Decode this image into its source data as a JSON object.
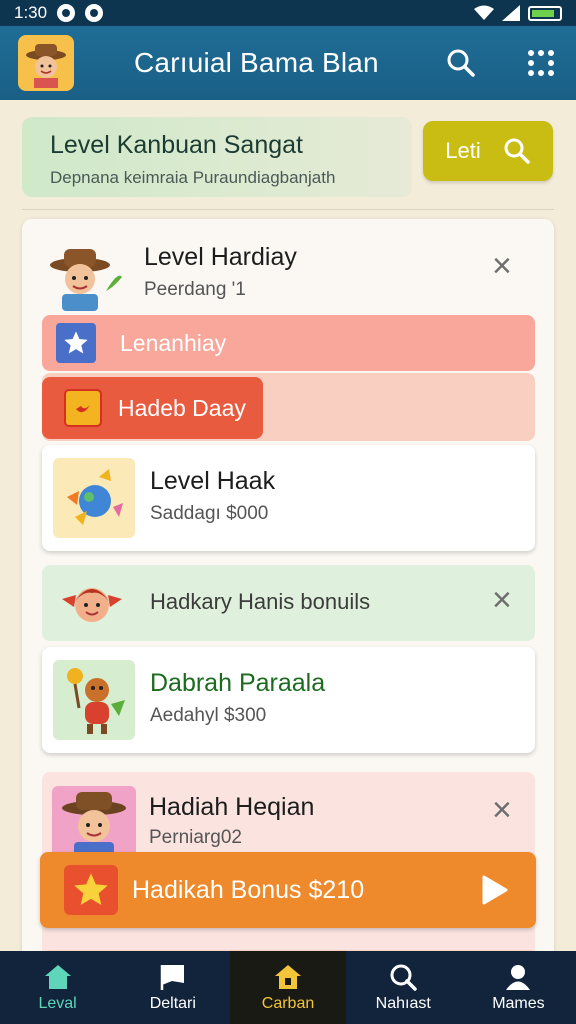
{
  "status_bar": {
    "time": "1:30",
    "signal_text": "↗"
  },
  "app_bar": {
    "title": "Carıuial Bama Blan"
  },
  "banner": {
    "title": "Level Kanbuan Sangat",
    "subtitle": "Depnana keimraia Puraundiagbanjath",
    "button_label": "Leti"
  },
  "panel": {
    "header": {
      "title": "Level Hardiay",
      "subtitle": "Peerdang '1"
    },
    "row_pink_label": "Lenanhiay",
    "row_red_label": "Hadeb Daay",
    "card1": {
      "title": "Level Haak",
      "subtitle": "Saddagı $000"
    },
    "row_green_label": "Hadkary Hanis bonuils",
    "card2": {
      "title": "Dabrah Paraala",
      "subtitle": "Aedahyl $300"
    },
    "section3": {
      "title": "Hadiah Heqian",
      "subtitle": "Perniarg02"
    },
    "bonus_label": "Hadikah Bonus $210"
  },
  "bottom_nav": [
    {
      "label": "Leval",
      "icon": "home-icon"
    },
    {
      "label": "Deltari",
      "icon": "flag-icon"
    },
    {
      "label": "Carban",
      "icon": "house-lock-icon"
    },
    {
      "label": "Nahıast",
      "icon": "search-icon"
    },
    {
      "label": "Mames",
      "icon": "person-icon"
    }
  ],
  "colors": {
    "app_bar": "#1f6d96",
    "banner_button": "#c9bd14",
    "bonus_bar": "#ee8a2c",
    "row_red": "#e95b3f",
    "nav_active_text": "#f2c53a"
  }
}
